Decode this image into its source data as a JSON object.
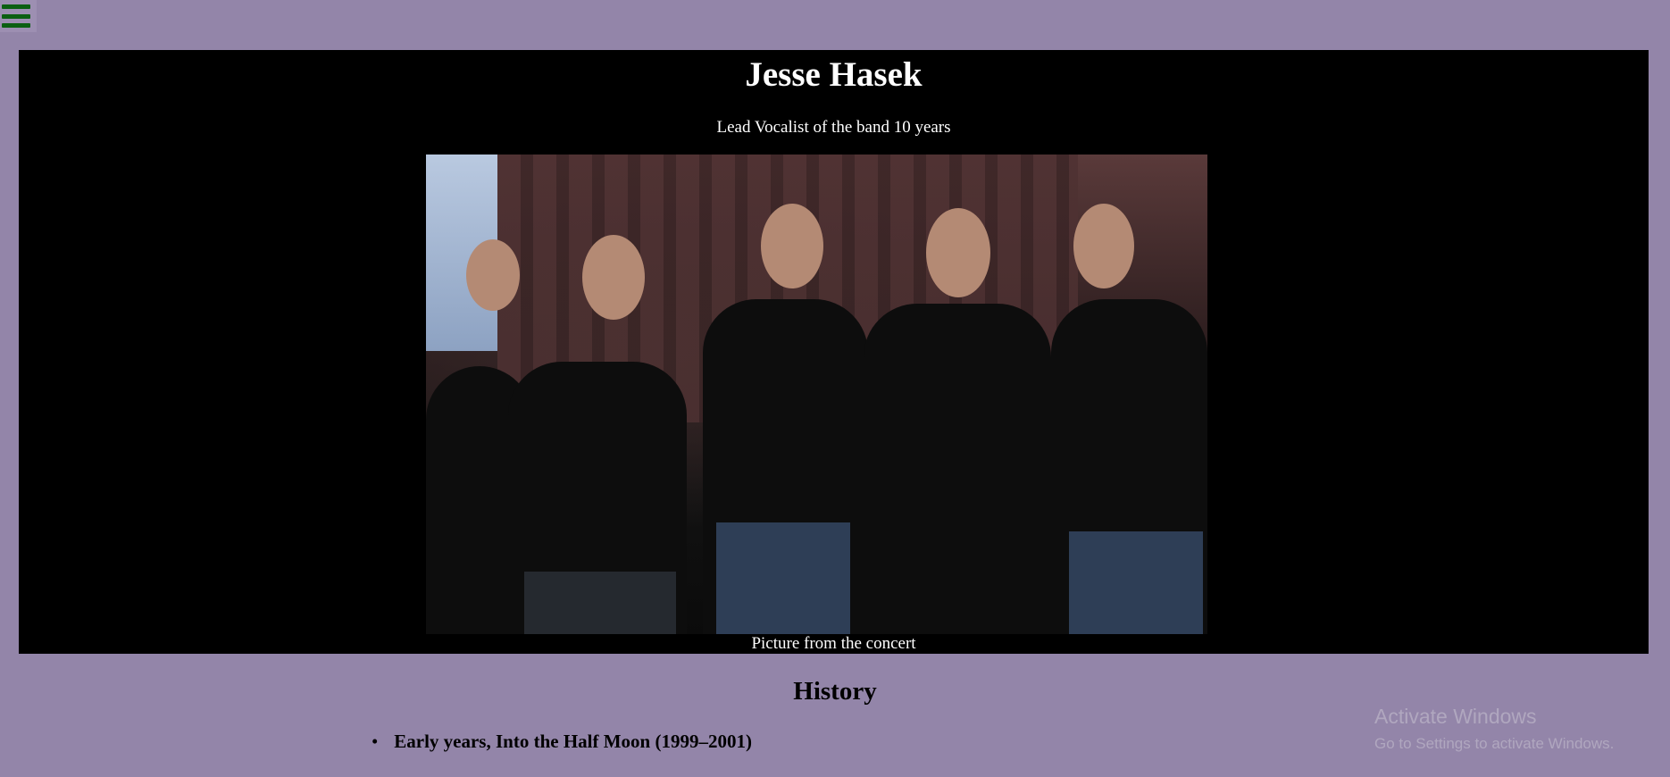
{
  "menu": {
    "icon": "hamburger-menu-icon",
    "icon_color": "#0b5f12"
  },
  "hero": {
    "title": "Jesse Hasek",
    "subtitle": "Lead Vocalist of the band 10 years",
    "image_alt": "Band photo of 10 Years",
    "caption": "Picture from the concert"
  },
  "history": {
    "heading": "History",
    "items": [
      {
        "label": "Early years, Into the Half Moon (1999–2001)"
      }
    ]
  },
  "watermark": {
    "line1": "Activate Windows",
    "line2": "Go to Settings to activate Windows."
  },
  "colors": {
    "page_background": "#9385a9",
    "hero_background": "#000000",
    "hero_text": "#ffffff"
  }
}
